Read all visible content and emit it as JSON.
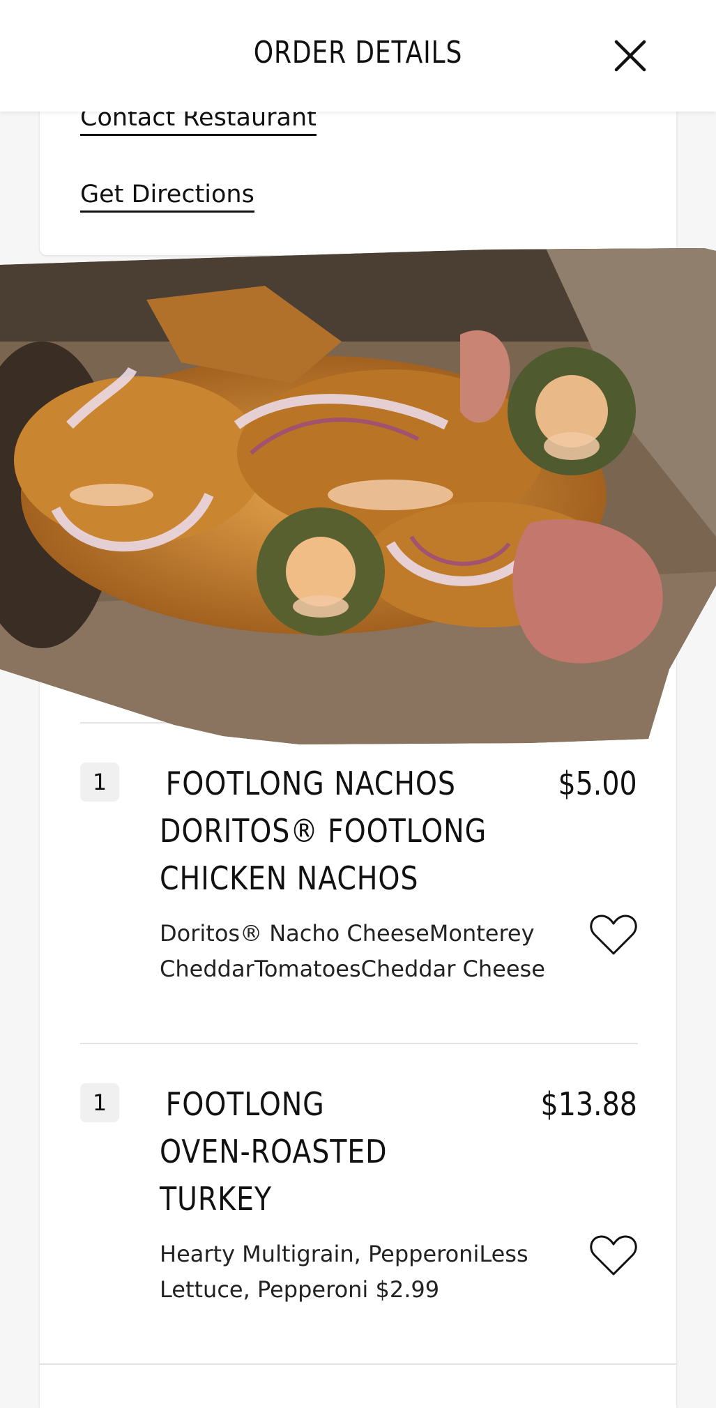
{
  "header": {
    "title": "ORDER DETAILS"
  },
  "restaurant": {
    "contact_label": "Contact Restaurant",
    "directions_label": "Get Directions"
  },
  "items": [
    {
      "quantity": "1",
      "title_lines": [
        "FOOTLONG NACHOS",
        "DORITOS® FOOTLONG",
        "CHICKEN NACHOS"
      ],
      "price": "$5.00",
      "description": "Doritos® Nacho CheeseMonterey CheddarTomatoesCheddar Cheese"
    },
    {
      "quantity": "1",
      "title_lines": [
        "FOOTLONG",
        "OVEN-ROASTED",
        "TURKEY"
      ],
      "price": "$13.88",
      "description": "Hearty Multigrain, PepperoniLess Lettuce, Pepperoni $2.99"
    }
  ],
  "colors": {
    "background": "#f6f6f6",
    "card": "#ffffff",
    "text": "#111111",
    "divider": "#e3e3e3",
    "badge": "#f0f0f0"
  }
}
